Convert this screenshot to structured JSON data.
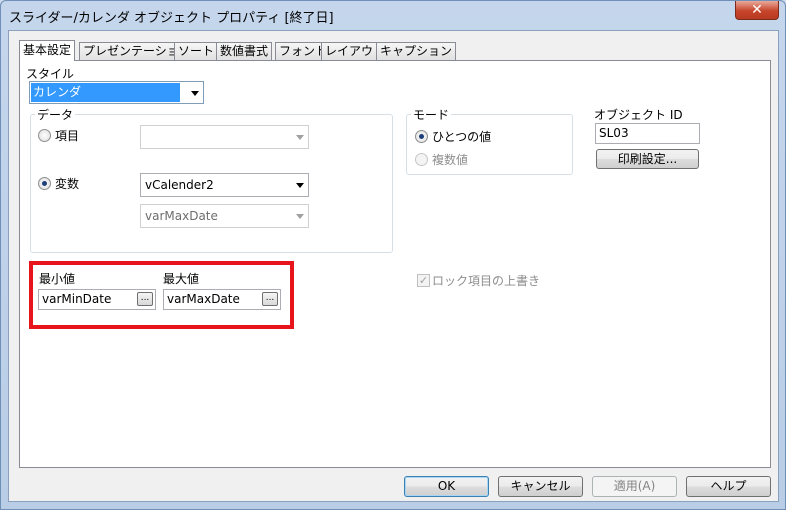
{
  "window": {
    "title": "スライダー/カレンダ オブジェクト プロパティ [終了日]",
    "close_glyph": "✕"
  },
  "tabs": [
    {
      "label": "基本設定",
      "active": true
    },
    {
      "label": "プレゼンテーション"
    },
    {
      "label": "ソート"
    },
    {
      "label": "数値書式"
    },
    {
      "label": "フォント"
    },
    {
      "label": "レイアウト"
    },
    {
      "label": "キャプション"
    }
  ],
  "style": {
    "label": "スタイル",
    "selected": "カレンダ"
  },
  "data_group": {
    "title": "データ",
    "field_radio": {
      "label": "項目",
      "checked": false,
      "value": ""
    },
    "variable_radio": {
      "label": "変数",
      "checked": true
    },
    "variable1": "vCalender2",
    "variable2": "varMaxDate"
  },
  "mode_group": {
    "title": "モード",
    "single": {
      "label": "ひとつの値",
      "checked": true
    },
    "multi": {
      "label": "複数値",
      "enabled": false
    }
  },
  "object_id": {
    "label": "オブジェクト ID",
    "value": "SL03"
  },
  "print_button": "印刷設定...",
  "min": {
    "label": "最小値",
    "value": "varMinDate",
    "button": "..."
  },
  "max": {
    "label": "最大値",
    "value": "varMaxDate",
    "button": "..."
  },
  "lock_override": {
    "label": "ロック項目の上書き",
    "checked": true,
    "enabled": false
  },
  "buttons": {
    "ok": "OK",
    "cancel": "キャンセル",
    "apply": "適用(A)",
    "help": "ヘルプ"
  },
  "colors": {
    "highlight": "#e8141b",
    "selection": "#3399ff"
  }
}
